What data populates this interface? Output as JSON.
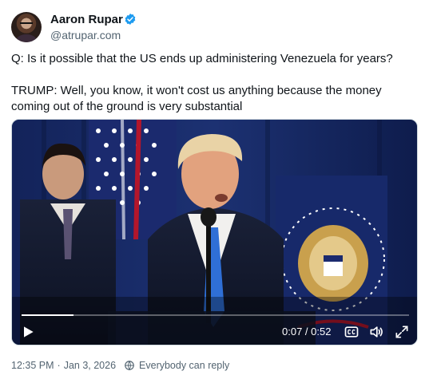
{
  "author": {
    "name": "Aaron Rupar",
    "handle": "@atrupar.com",
    "verified_color": "#1d9bf0"
  },
  "tweet": {
    "line1": "Q: Is it possible that the US ends up administering Venezuela for years?",
    "line2": "TRUMP: Well, you know, it won't cost us anything because the money coming out of the ground is very substantial"
  },
  "video": {
    "current_time": "0:07",
    "separator": " / ",
    "duration": "0:52",
    "progress_fraction": 0.135,
    "icons": {
      "play": "play-icon",
      "captions": "closed-captions-icon",
      "volume": "volume-icon",
      "fullscreen": "fullscreen-icon"
    }
  },
  "footer": {
    "time": "12:35 PM",
    "dot": "·",
    "date": "Jan 3, 2026",
    "reply_setting": "Everybody can reply"
  },
  "colors": {
    "text": "#0f1419",
    "secondary": "#536471",
    "video_bg": "#0f1d4a"
  }
}
